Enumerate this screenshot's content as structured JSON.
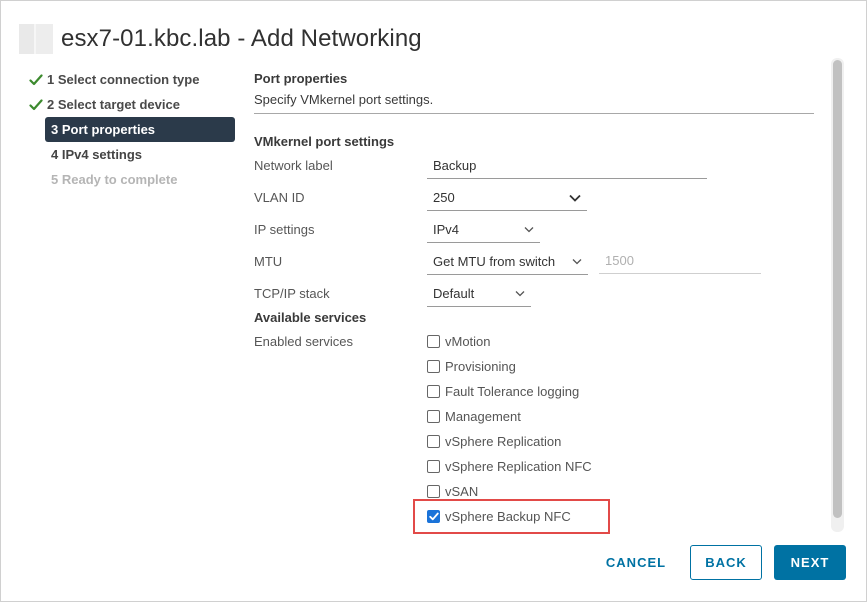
{
  "dialog": {
    "host": "esx7-01.kbc.lab",
    "separator": " - ",
    "title": "Add Networking"
  },
  "steps": [
    {
      "label": "1 Select connection type",
      "state": "done"
    },
    {
      "label": "2 Select target device",
      "state": "done"
    },
    {
      "label": "3 Port properties",
      "state": "active"
    },
    {
      "label": "4 IPv4 settings",
      "state": "todo"
    },
    {
      "label": "5 Ready to complete",
      "state": "disabled"
    }
  ],
  "content": {
    "section_title": "Port properties",
    "section_subtitle": "Specify VMkernel port settings.",
    "settings_heading": "VMkernel port settings",
    "network_label": {
      "label": "Network label",
      "value": "Backup"
    },
    "vlan_id": {
      "label": "VLAN ID",
      "value": "250"
    },
    "ip_settings": {
      "label": "IP settings",
      "value": "IPv4"
    },
    "mtu": {
      "label": "MTU",
      "value": "Get MTU from switch",
      "number_placeholder": "1500"
    },
    "tcpip_stack": {
      "label": "TCP/IP stack",
      "value": "Default"
    },
    "available_services": "Available services",
    "enabled_services_label": "Enabled services",
    "services": [
      {
        "label": "vMotion",
        "checked": false
      },
      {
        "label": "Provisioning",
        "checked": false
      },
      {
        "label": "Fault Tolerance logging",
        "checked": false
      },
      {
        "label": "Management",
        "checked": false
      },
      {
        "label": "vSphere Replication",
        "checked": false
      },
      {
        "label": "vSphere Replication NFC",
        "checked": false
      },
      {
        "label": "vSAN",
        "checked": false
      },
      {
        "label": "vSphere Backup NFC",
        "checked": true
      }
    ]
  },
  "footer": {
    "cancel": "CANCEL",
    "back": "BACK",
    "next": "NEXT"
  },
  "colors": {
    "accent": "#0072a3",
    "active_step_bg": "#2b3a4a",
    "check_green": "#3c8a2e",
    "highlight_box": "#e24a48",
    "checkbox_checked": "#1a73d9"
  },
  "icons": {
    "host": "host-icon",
    "done_step": "checkmark-icon",
    "dropdown": "chevron-down-icon"
  }
}
